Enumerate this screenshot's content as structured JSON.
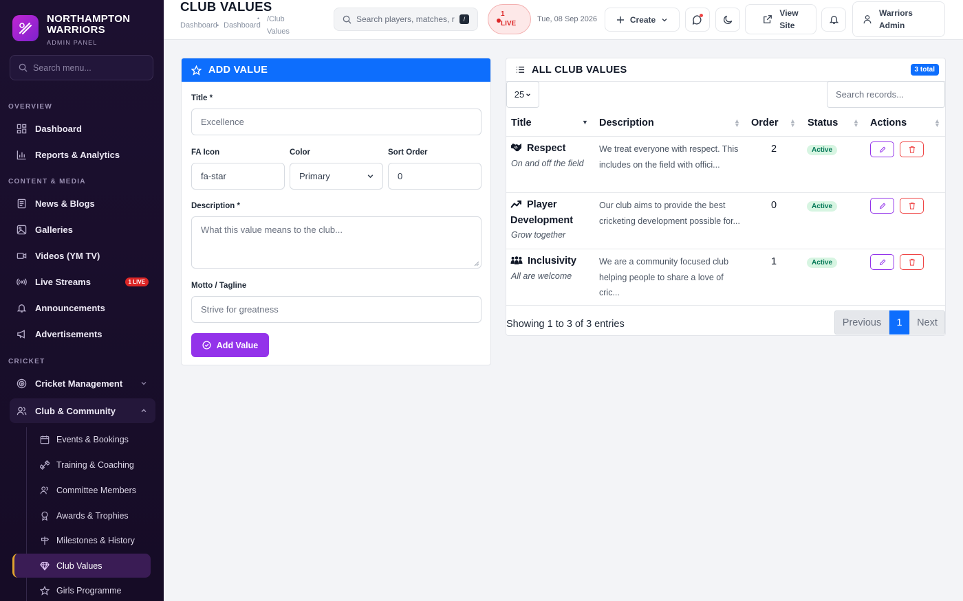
{
  "brand": {
    "name_line1": "NORTHAMPTON",
    "name_line2": "WARRIORS",
    "subtitle": "ADMIN PANEL"
  },
  "sidebar": {
    "search_placeholder": "Search menu...",
    "sections": {
      "overview": "OVERVIEW",
      "content": "CONTENT & MEDIA",
      "cricket": "CRICKET"
    },
    "items": {
      "dashboard": "Dashboard",
      "reports": "Reports & Analytics",
      "news": "News & Blogs",
      "galleries": "Galleries",
      "videos": "Videos (YM TV)",
      "live_streams": "Live Streams",
      "live_badge": "1 LIVE",
      "announcements": "Announcements",
      "advertisements": "Advertisements",
      "cricket_management": "Cricket Management",
      "club_community": "Club & Community"
    },
    "sub_items": {
      "events": "Events & Bookings",
      "training": "Training & Coaching",
      "committee": "Committee Members",
      "awards": "Awards & Trophies",
      "milestones": "Milestones & History",
      "club_values": "Club Values",
      "girls": "Girls Programme"
    }
  },
  "header": {
    "title": "CLUB VALUES",
    "breadcrumb": [
      "Dashboard",
      "Dashboard",
      "/Club",
      "Values"
    ],
    "search_placeholder": "Search players, matches, r",
    "kbd": "/",
    "live_count": "1",
    "live_label": "LIVE",
    "date": "Tue, 08 Sep 2026",
    "create_label": "Create",
    "view_site": [
      "View",
      "Site"
    ],
    "admin": [
      "Warriors",
      "Admin"
    ]
  },
  "form": {
    "heading": "ADD VALUE",
    "title_label": "Title *",
    "title_placeholder": "Excellence",
    "icon_label": "FA Icon",
    "icon_value": "fa-star",
    "color_label": "Color",
    "color_value": "Primary",
    "order_label": "Sort Order",
    "order_value": "0",
    "desc_label": "Description *",
    "desc_placeholder": "What this value means to the club...",
    "motto_label": "Motto / Tagline",
    "motto_placeholder": "Strive for greatness",
    "submit_label": "Add Value"
  },
  "table": {
    "heading": "ALL CLUB VALUES",
    "total": "3 total",
    "page_length": "25",
    "search_placeholder": "Search records...",
    "columns": [
      "Title",
      "Description",
      "Order",
      "Status",
      "Actions"
    ],
    "rows": [
      {
        "icon": "handshake-icon",
        "title": "Respect",
        "motto": "On and off the field",
        "desc": "We treat everyone with respect. This includes on the field with offici...",
        "order": "2",
        "status": "Active"
      },
      {
        "icon": "trend-up-icon",
        "title": "Player Development",
        "motto": "Grow together",
        "desc": "Our club aims to provide the best cricketing development possible for...",
        "order": "0",
        "status": "Active"
      },
      {
        "icon": "people-group-icon",
        "title": "Inclusivity",
        "motto": "All are welcome",
        "desc": "We are a community focused club helping people to share a love of cric...",
        "order": "1",
        "status": "Active"
      }
    ],
    "info": "Showing 1 to 3 of 3 entries",
    "prev": "Previous",
    "page": "1",
    "next": "Next"
  }
}
